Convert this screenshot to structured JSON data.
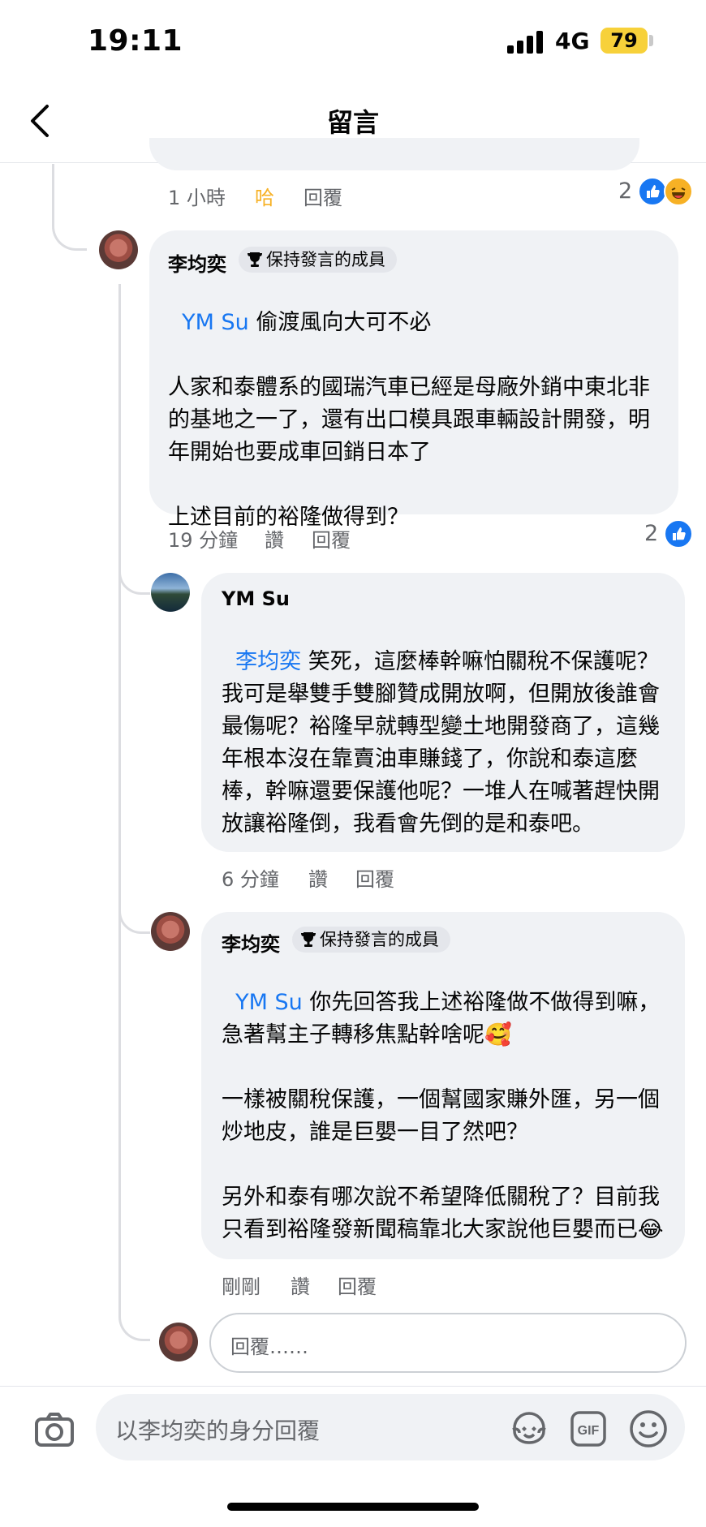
{
  "status_bar": {
    "time": "19:11",
    "network": "4G",
    "battery": "79"
  },
  "header": {
    "title": "留言"
  },
  "top_comment_meta": {
    "time": "1 小時",
    "reaction": "哈",
    "reply": "回覆",
    "reaction_count": "2"
  },
  "comments": [
    {
      "author": "李均奕",
      "badge": "保持發言的成員",
      "mention": "YM Su",
      "text_first": " 偷渡風向大可不必",
      "text_rest": "\n\n人家和泰體系的國瑞汽車已經是母廠外銷中東北非的基地之一了，還有出口模具跟車輛設計開發，明年開始也要成車回銷日本了\n\n上述目前的裕隆做得到？",
      "time": "19 分鐘",
      "like": "讚",
      "reply": "回覆",
      "reaction_count": "2"
    },
    {
      "author": "YM Su",
      "mention": "李均奕",
      "text_first": " 笑死，這麼棒幹嘛怕關稅不保護呢？我可是舉雙手雙腳贊成開放啊，但開放後誰會最傷呢？裕隆早就轉型變土地開發商了，這幾年根本沒在靠賣油車賺錢了，你說和泰這麼棒，幹嘛還要保護他呢？一堆人在喊著趕快開放讓裕隆倒，我看會先倒的是和泰吧。",
      "time": "6 分鐘",
      "like": "讚",
      "reply": "回覆"
    },
    {
      "author": "李均奕",
      "badge": "保持發言的成員",
      "mention": "YM Su",
      "text_first": " 你先回答我上述裕隆做不做得到嘛，急著幫主子轉移焦點幹啥呢🥰\n\n一樣被關稅保護，一個幫國家賺外匯，另一個炒地皮，誰是巨嬰一目了然吧？\n\n另外和泰有哪次說不希望降低關稅了？目前我只看到裕隆發新聞稿靠北大家說他巨嬰而已😂",
      "time": "剛剛",
      "like": "讚",
      "reply": "回覆"
    }
  ],
  "reply_box": {
    "placeholder": "回覆……"
  },
  "composer": {
    "placeholder": "以李均奕的身分回覆"
  },
  "icons": [
    "back-arrow-icon",
    "trophy-icon",
    "like-icon",
    "haha-icon",
    "camera-icon",
    "avatar-sticker-icon",
    "gif-icon",
    "emoji-icon"
  ],
  "colors": {
    "mention": "#1877f2",
    "bubble": "#f0f2f5",
    "meta": "#65676b",
    "haha": "#f7b125"
  }
}
